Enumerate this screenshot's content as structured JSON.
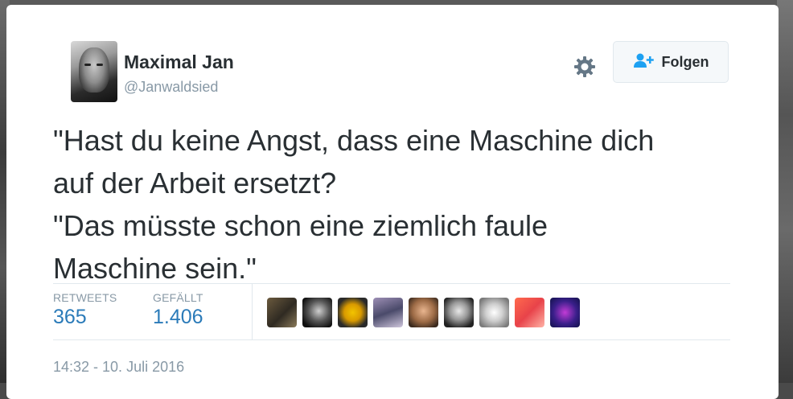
{
  "tweet": {
    "author": {
      "name": "Maximal Jan",
      "handle": "@Janwaldsied"
    },
    "follow_button": {
      "label": "Folgen",
      "icon": "add-user-icon"
    },
    "settings_icon": "gear-icon",
    "text_lines": [
      "\"Hast du keine Angst, dass eine Maschine dich",
      "auf der Arbeit ersetzt?",
      "\"Das müsste schon eine ziemlich faule",
      "Maschine sein.\""
    ],
    "stats": {
      "retweets_label": "RETWEETS",
      "retweets_value": "365",
      "likes_label": "GEFÄLLT",
      "likes_value": "1.406"
    },
    "liker_avatar_count": 9,
    "timestamp": "14:32 - 10. Juli 2016"
  },
  "colors": {
    "text_primary": "#292f33",
    "text_secondary": "#8899a6",
    "accent_blue": "#2b7bb9",
    "border": "#e1e8ed"
  }
}
